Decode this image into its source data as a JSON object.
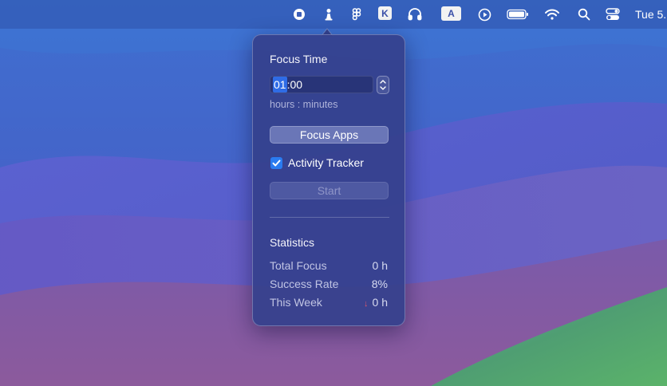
{
  "menubar": {
    "icons": [
      "record-icon",
      "pawn-icon",
      "figma-icon",
      "k-icon",
      "headphones-icon",
      "a-icon",
      "play-icon",
      "battery-icon",
      "wifi-icon",
      "search-icon",
      "control-center-icon"
    ],
    "k_label": "K",
    "a_label": "A",
    "clock": "Tue 5."
  },
  "popover": {
    "title": "Focus Time",
    "time_hours": "01",
    "time_sep": ":",
    "time_minutes": "00",
    "time_hint": "hours : minutes",
    "focus_apps_label": "Focus Apps",
    "activity_tracker_label": "Activity Tracker",
    "activity_tracker_checked": true,
    "start_label": "Start",
    "statistics": {
      "title": "Statistics",
      "rows": [
        {
          "label": "Total Focus",
          "value": "0 h"
        },
        {
          "label": "Success Rate",
          "value": "8%"
        },
        {
          "label": "This Week",
          "trend": "↓",
          "value": "0 h"
        }
      ]
    }
  },
  "colors": {
    "accent": "#2a7bf0",
    "trend_down": "#e0566a",
    "wallpaper_green": "#5aa86a"
  }
}
